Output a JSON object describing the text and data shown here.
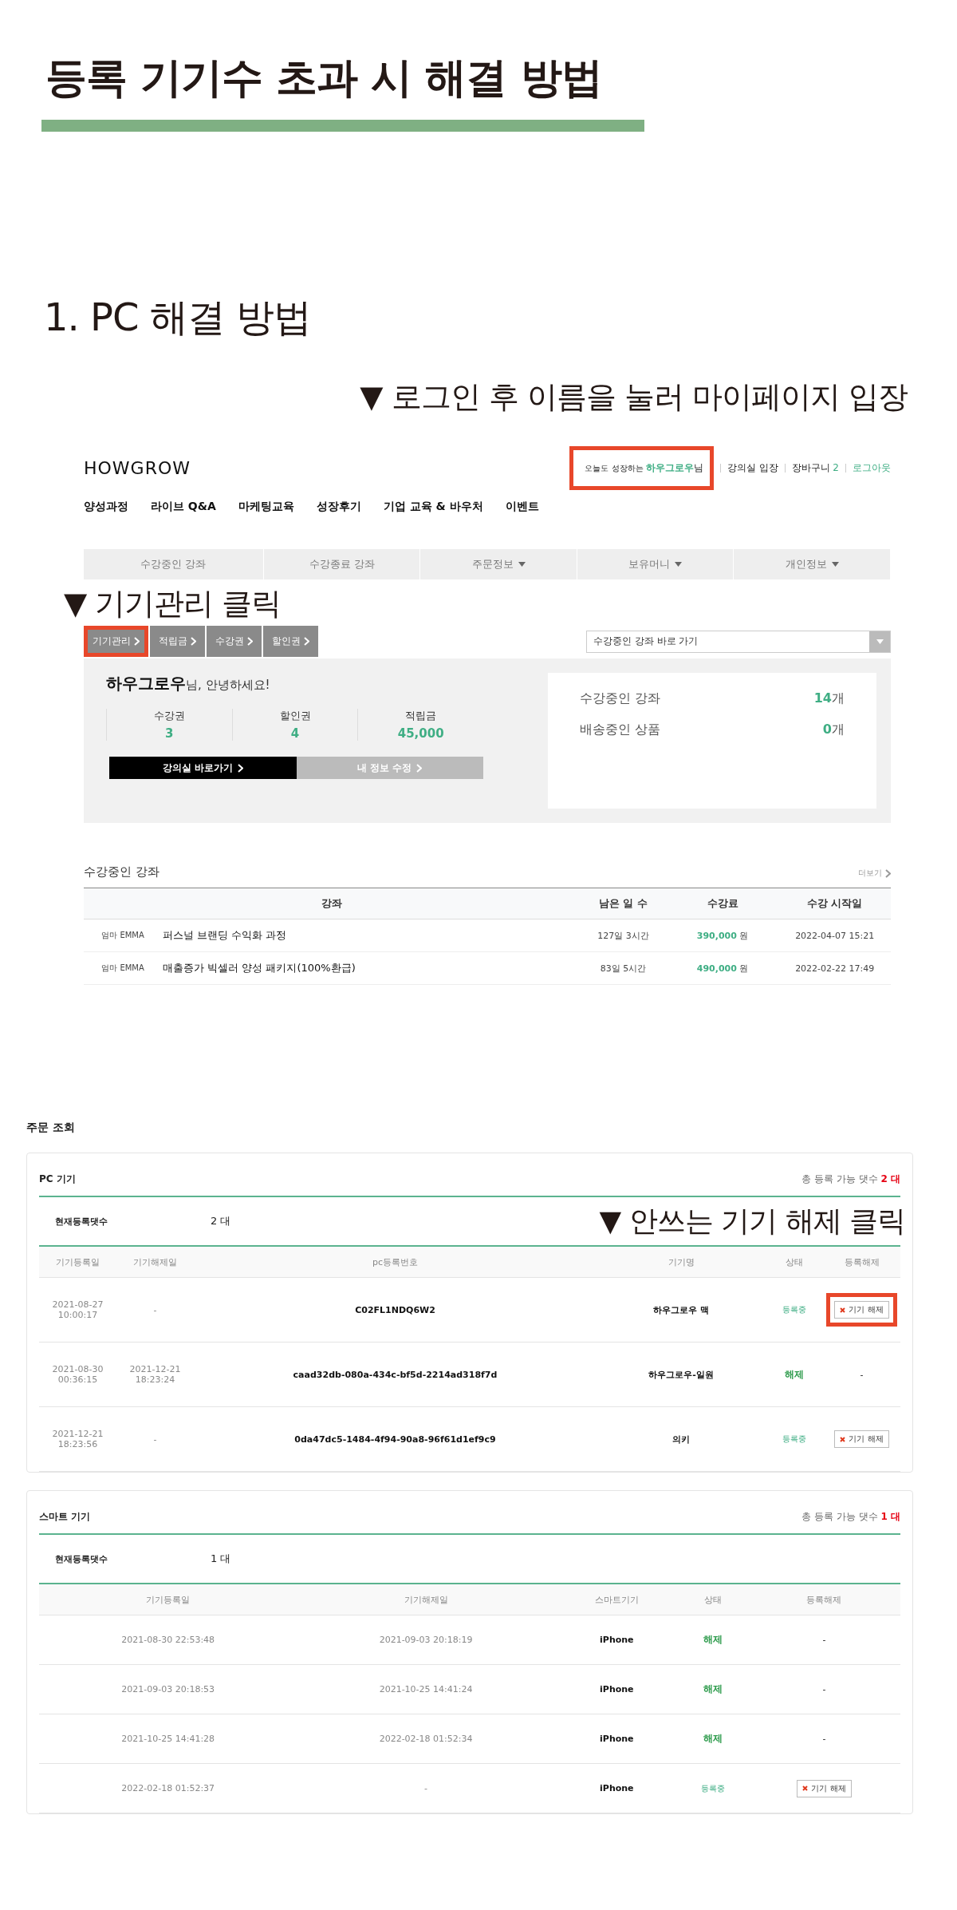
{
  "title": "등록 기기수 초과 시 해결 방법",
  "section_heading": "1. PC 해결 방법",
  "step_note_1": "▼ 로그인 후 이름을 눌러 마이페이지 입장",
  "site": {
    "logo": "HOWGROW",
    "greeting": {
      "prefix": "오늘도 성장하는",
      "name": "하우그로우",
      "suffix": "님",
      "highlighted": true
    },
    "top_links": [
      {
        "label": "강의실 입장",
        "kind": "plain"
      },
      {
        "label": "장바구니",
        "count": "2",
        "kind": "count"
      },
      {
        "label": "로그아웃",
        "kind": "accent"
      }
    ],
    "nav": [
      "양성과정",
      "라이브 Q&A",
      "마케팅교육",
      "성장후기",
      "기업 교육 & 바우처",
      "이벤트"
    ],
    "mypage_tabs": [
      {
        "label": "수강중인 강좌",
        "dropdown": false
      },
      {
        "label": "수강종료 강좌",
        "dropdown": false
      },
      {
        "label": "주문정보",
        "dropdown": true
      },
      {
        "label": "보유머니",
        "dropdown": true
      },
      {
        "label": "개인정보",
        "dropdown": true
      }
    ],
    "step_note_2": "▼ 기기관리 클릭",
    "quick_links": [
      {
        "label": "기기관리",
        "highlighted": true
      },
      {
        "label": "적립금",
        "highlighted": false
      },
      {
        "label": "수강권",
        "highlighted": false
      },
      {
        "label": "할인권",
        "highlighted": false
      }
    ],
    "jump_select": {
      "value": "수강중인 강좌 바로 가기"
    },
    "profile": {
      "name": "하우그로우",
      "suffix": "님, 안녕하세요!",
      "stats": [
        {
          "label": "수강권",
          "value": "3"
        },
        {
          "label": "할인권",
          "value": "4"
        },
        {
          "label": "적립금",
          "value": "45,000"
        }
      ],
      "buttons": [
        {
          "label": "강의실 바로가기",
          "kind": "primary"
        },
        {
          "label": "내 정보 수정",
          "kind": "secondary"
        }
      ],
      "counts": [
        {
          "label": "수강중인 강좌",
          "value": "14",
          "unit": "개"
        },
        {
          "label": "배송중인 상품",
          "value": "0",
          "unit": "개"
        }
      ]
    },
    "courses": {
      "title": "수강중인 강좌",
      "more": "더보기",
      "columns": [
        "강좌",
        "남은 일 수",
        "수강료",
        "수강 시작일"
      ],
      "rows": [
        {
          "instructor": "엄마 EMMA",
          "title": "퍼스널 브랜딩 수익화 과정",
          "remaining": "127일 3시간",
          "price": "390,000",
          "currency": "원",
          "start": "2022-04-07 15:21"
        },
        {
          "instructor": "엄마 EMMA",
          "title": "매출증가 빅셀러 양성 패키지(100%환급)",
          "remaining": "83일 5시간",
          "price": "490,000",
          "currency": "원",
          "start": "2022-02-22 17:49"
        }
      ]
    }
  },
  "orders": {
    "heading": "주문 조회",
    "device_groups": [
      {
        "kind": "pc",
        "title": "PC 기기",
        "capacity_label": "총 등록 가능 댓수",
        "capacity": "2 대",
        "current_label": "현재등록댓수",
        "current": "2 대",
        "note": "▼ 안쓰는 기기 해제 클릭",
        "columns": [
          {
            "label": "기기등록일",
            "kind": "date"
          },
          {
            "label": "기기해제일",
            "kind": "date"
          },
          {
            "label": "pc등록번호",
            "kind": "text"
          },
          {
            "label": "기기명",
            "kind": "text"
          },
          {
            "label": "상태",
            "kind": "status"
          },
          {
            "label": "등록해제",
            "kind": "action"
          }
        ],
        "rows": [
          {
            "cells": [
              "2021-08-27 10:00:17",
              "-",
              "C02FL1NDQ6W2",
              "하우그로우 맥"
            ],
            "status": {
              "label": "등록중",
              "kind": "active"
            },
            "action": {
              "kind": "button",
              "label": "기기 해제",
              "highlighted": true
            }
          },
          {
            "cells": [
              "2021-08-30 00:36:15",
              "2021-12-21 18:23:24",
              "caad32db-080a-434c-bf5d-2214ad318f7d",
              "하우그로우-일원"
            ],
            "status": {
              "label": "해제",
              "kind": "released"
            },
            "action": {
              "kind": "none",
              "label": "-"
            }
          },
          {
            "cells": [
              "2021-12-21 18:23:56",
              "-",
              "0da47dc5-1484-4f94-90a8-96f61d1ef9c9",
              "의키"
            ],
            "status": {
              "label": "등록중",
              "kind": "active"
            },
            "action": {
              "kind": "button",
              "label": "기기 해제",
              "highlighted": false
            }
          }
        ]
      },
      {
        "kind": "smart",
        "title": "스마트 기기",
        "capacity_label": "총 등록 가능 댓수",
        "capacity": "1 대",
        "current_label": "현재등록댓수",
        "current": "1 대",
        "columns": [
          {
            "label": "기기등록일",
            "kind": "date"
          },
          {
            "label": "기기해제일",
            "kind": "date"
          },
          {
            "label": "스마트기기",
            "kind": "text"
          },
          {
            "label": "상태",
            "kind": "status"
          },
          {
            "label": "등록해제",
            "kind": "action"
          }
        ],
        "rows": [
          {
            "cells": [
              "2021-08-30 22:53:48",
              "2021-09-03 20:18:19",
              "iPhone"
            ],
            "status": {
              "label": "해제",
              "kind": "released"
            },
            "action": {
              "kind": "none",
              "label": "-"
            }
          },
          {
            "cells": [
              "2021-09-03 20:18:53",
              "2021-10-25 14:41:24",
              "iPhone"
            ],
            "status": {
              "label": "해제",
              "kind": "released"
            },
            "action": {
              "kind": "none",
              "label": "-"
            }
          },
          {
            "cells": [
              "2021-10-25 14:41:28",
              "2022-02-18 01:52:34",
              "iPhone"
            ],
            "status": {
              "label": "해제",
              "kind": "released"
            },
            "action": {
              "kind": "none",
              "label": "-"
            }
          },
          {
            "cells": [
              "2022-02-18 01:52:37",
              "-",
              "iPhone"
            ],
            "status": {
              "label": "등록중",
              "kind": "active"
            },
            "action": {
              "kind": "button",
              "label": "기기 해제",
              "highlighted": false
            }
          }
        ]
      }
    ]
  }
}
